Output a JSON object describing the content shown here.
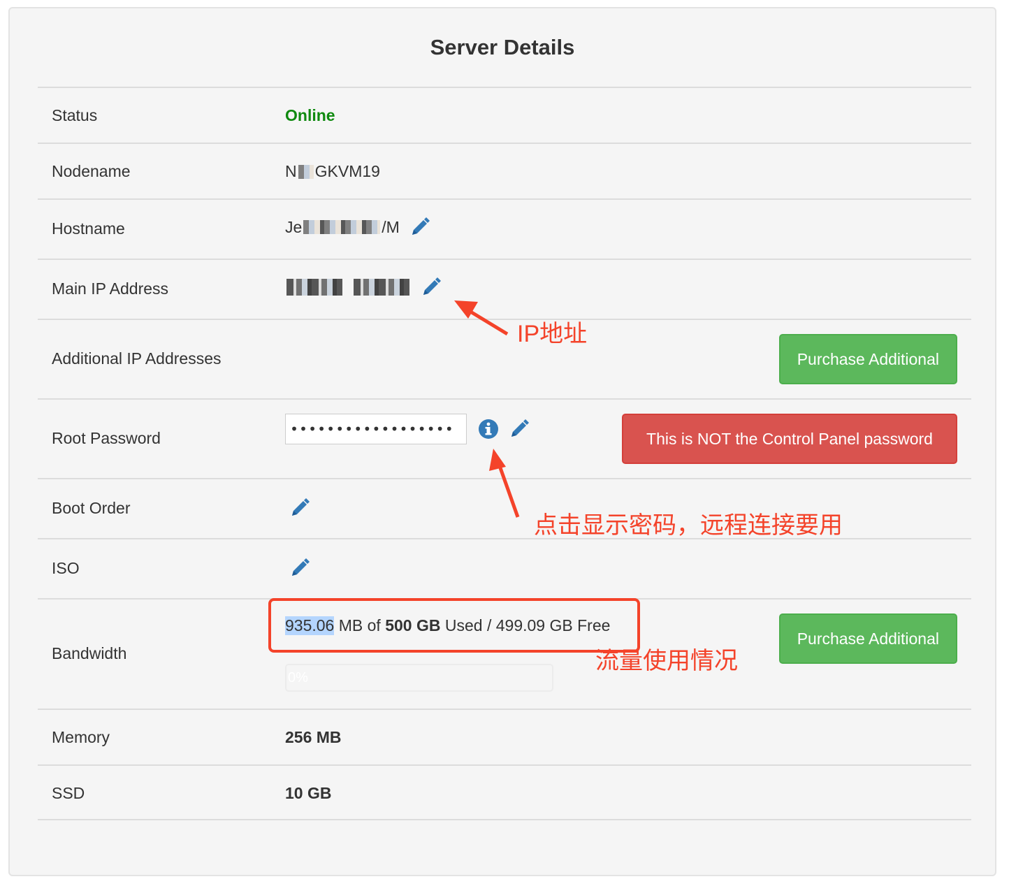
{
  "panel": {
    "title": "Server Details"
  },
  "rows": {
    "status": {
      "label": "Status",
      "value": "Online"
    },
    "nodename": {
      "label": "Nodename",
      "value_prefix": "N",
      "value_suffix": "GKVM19"
    },
    "hostname": {
      "label": "Hostname",
      "value_prefix": "Je",
      "value_suffix": "/M"
    },
    "main_ip": {
      "label": "Main IP Address"
    },
    "additional_ip": {
      "label": "Additional IP Addresses",
      "button": "Purchase Additional"
    },
    "root_password": {
      "label": "Root Password",
      "value": "••••••••••••••••••",
      "warning": "This is NOT the Control Panel password"
    },
    "boot_order": {
      "label": "Boot Order"
    },
    "iso": {
      "label": "ISO"
    },
    "bandwidth": {
      "label": "Bandwidth",
      "used": "935.06",
      "used_unit": " MB of ",
      "total": "500 GB",
      "used_text": " Used / ",
      "free": "499.09 GB Free",
      "progress_label": "0%",
      "progress_percent": 0,
      "button": "Purchase Additional"
    },
    "memory": {
      "label": "Memory",
      "value": "256 MB"
    },
    "ssd": {
      "label": "SSD",
      "value": "10 GB"
    }
  },
  "annotations": {
    "ip": "IP地址",
    "password": "点击显示密码，远程连接要用",
    "bandwidth": "流量使用情况",
    "color": "#f4432a"
  },
  "colors": {
    "green": "#5cb85c",
    "red": "#d9534f",
    "online": "#108a10",
    "icon_blue": "#337ab7"
  }
}
